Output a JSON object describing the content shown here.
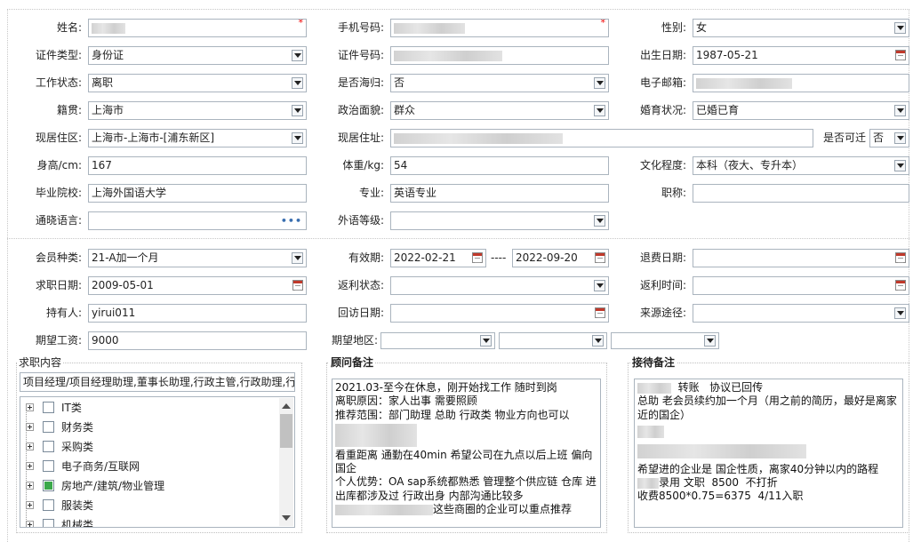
{
  "basic": {
    "name": {
      "label": "姓名:",
      "value": ""
    },
    "phone": {
      "label": "手机号码:",
      "value": ""
    },
    "gender": {
      "label": "性别:",
      "value": "女"
    },
    "id_type": {
      "label": "证件类型:",
      "value": "身份证"
    },
    "id_no": {
      "label": "证件号码:",
      "value": ""
    },
    "birth": {
      "label": "出生日期:",
      "value": "1987-05-21"
    },
    "work_status": {
      "label": "工作状态:",
      "value": "离职"
    },
    "overseas": {
      "label": "是否海归:",
      "value": "否"
    },
    "email": {
      "label": "电子邮箱:",
      "value": ""
    },
    "native": {
      "label": "籍贯:",
      "value": "上海市"
    },
    "politics": {
      "label": "政治面貌:",
      "value": "群众"
    },
    "marital": {
      "label": "婚育状况:",
      "value": "已婚已育"
    },
    "region": {
      "label": "现居住区:",
      "value": "上海市-上海市-[浦东新区]"
    },
    "address": {
      "label": "现居住址:",
      "value": ""
    },
    "relocate": {
      "label": "是否可迁",
      "value": "否"
    },
    "height": {
      "label": "身高/cm:",
      "value": "167"
    },
    "weight": {
      "label": "体重/kg:",
      "value": "54"
    },
    "education": {
      "label": "文化程度:",
      "value": "本科（夜大、专升本）"
    },
    "school": {
      "label": "毕业院校:",
      "value": "上海外国语大学"
    },
    "major": {
      "label": "专业:",
      "value": "英语专业"
    },
    "title": {
      "label": "职称:",
      "value": ""
    },
    "language": {
      "label": "通晓语言:",
      "value": ""
    },
    "foreign_level": {
      "label": "外语等级:",
      "value": ""
    }
  },
  "member": {
    "type": {
      "label": "会员种类:",
      "value": "21-A加一个月"
    },
    "valid": {
      "label": "有效期:",
      "from": "2022-02-21",
      "sep": "----",
      "to": "2022-09-20"
    },
    "refund_date": {
      "label": "退费日期:",
      "value": ""
    },
    "job_date": {
      "label": "求职日期:",
      "value": "2009-05-01"
    },
    "rebate_status": {
      "label": "返利状态:",
      "value": ""
    },
    "rebate_time": {
      "label": "返利时间:",
      "value": ""
    },
    "holder": {
      "label": "持有人:",
      "value": "yirui011"
    },
    "visit_date": {
      "label": "回访日期:",
      "value": ""
    },
    "source": {
      "label": "来源途径:",
      "value": ""
    },
    "salary": {
      "label": "期望工资:",
      "value": "9000"
    },
    "area": {
      "label": "期望地区:",
      "value": ""
    }
  },
  "job_content": {
    "title": "求职内容",
    "selected": "项目经理/项目经理助理,董事长助理,行政主管,行政助理,行",
    "categories": [
      {
        "label": "IT类",
        "checked": "none"
      },
      {
        "label": "财务类",
        "checked": "none"
      },
      {
        "label": "采购类",
        "checked": "none"
      },
      {
        "label": "电子商务/互联网",
        "checked": "none"
      },
      {
        "label": "房地产/建筑/物业管理",
        "checked": "partial"
      },
      {
        "label": "服装类",
        "checked": "none"
      },
      {
        "label": "机械类",
        "checked": "none"
      }
    ]
  },
  "consultant": {
    "title": "顾问备注",
    "lines": [
      "2021.03-至今在休息，刚开始找工作 随时到岗",
      "离职原因：家人出事 需要照顾",
      "推荐范围：部门助理 总助 行政类 物业方向也可以",
      "",
      "",
      "看重距离 通勤在40min 希望公司在九点以后上班 偏向国企",
      "个人优势：OA sap系统都熟悉 管理整个供应链 仓库 进出库都涉及过 行政出身 内部沟通比较多",
      "这些商圈的企业可以重点推荐"
    ]
  },
  "reception": {
    "title": "接待备注",
    "lines": [
      "转账   协议已回传",
      "总助 老会员续约加一个月（用之前的简历，最好是离家近的国企）",
      "",
      "",
      "",
      "希望进的企业是 国企性质，离家40分钟以内的路程",
      "录用 文职  8500  不打折",
      "收费8500*0.75=6375  4/11入职"
    ]
  },
  "icons": [
    "dropdown-arrow-icon",
    "calendar-icon",
    "more-dots-icon",
    "expand-plus-icon",
    "checkbox-icon"
  ],
  "colors": {
    "required_star": "#e00000",
    "border": "#aab4be",
    "checked_green": "#3aa84a",
    "dots_blue": "#3a6fb0"
  }
}
